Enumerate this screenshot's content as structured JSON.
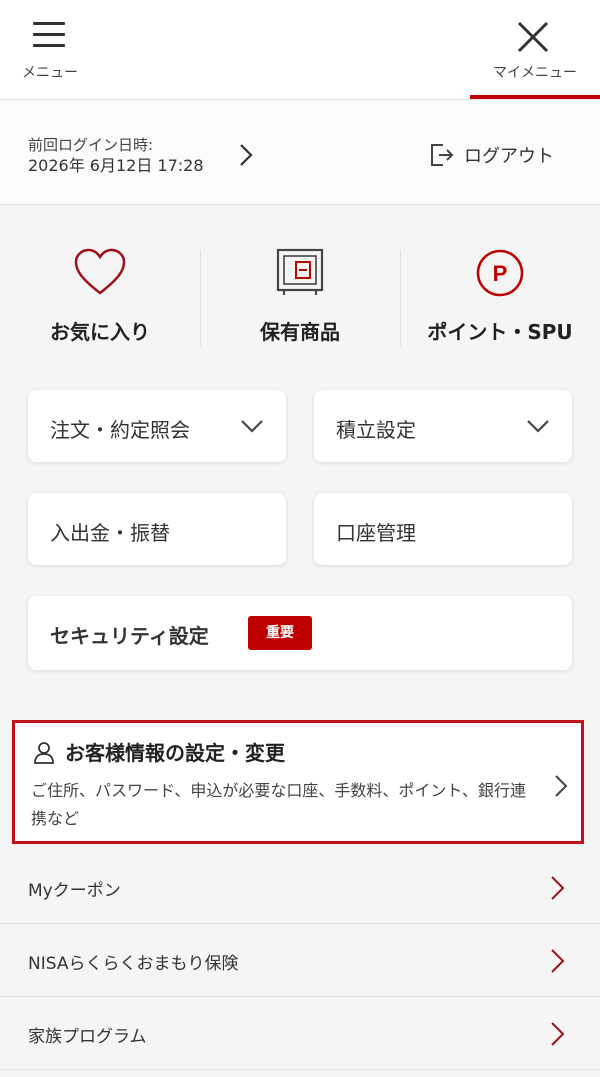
{
  "header": {
    "menu_label": "メニュー",
    "mymenu_label": "マイメニュー"
  },
  "login": {
    "last_login_label": "前回ログイン日時:",
    "last_login_value": "2026年 6月12日 17:28",
    "logout_label": "ログアウト"
  },
  "quick_links": [
    {
      "label": "お気に入り",
      "icon": "heart-icon"
    },
    {
      "label": "保有商品",
      "icon": "safe-icon"
    },
    {
      "label": "ポイント・SPU",
      "icon": "point-p-icon"
    }
  ],
  "cards": {
    "orders": "注文・約定照会",
    "savings": "積立設定",
    "deposit": "入出金・振替",
    "account": "口座管理",
    "security": "セキュリティ設定",
    "security_badge": "重要"
  },
  "customer": {
    "title": "お客様情報の設定・変更",
    "description": "ご住所、パスワード、申込が必要な口座、手数料、ポイント、銀行連携など"
  },
  "list": [
    {
      "label": "Myクーポン"
    },
    {
      "label": "NISAらくらくおまもり保険"
    },
    {
      "label": "家族プログラム"
    }
  ],
  "colors": {
    "accent": "#bf0000",
    "highlight_border": "#c0121c"
  }
}
